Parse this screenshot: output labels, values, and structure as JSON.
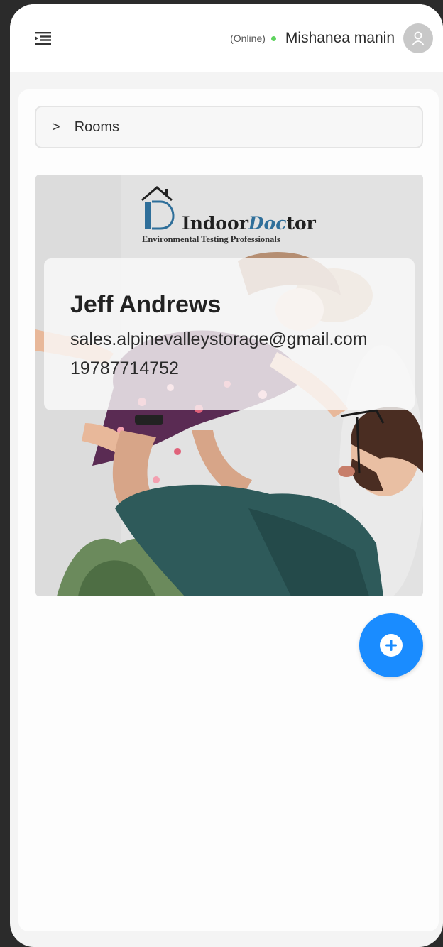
{
  "header": {
    "menu_icon": "menu-collapse-icon",
    "status_text": "(Online)",
    "status_color": "#5fd35f",
    "user_name": "Mishanea manin",
    "avatar_icon": "user-icon"
  },
  "rooms": {
    "label": "Rooms",
    "chevron": ">"
  },
  "customer_card": {
    "logo": {
      "brand_part1": "Indoor",
      "brand_part2": "Doc",
      "brand_part3": "tor",
      "tagline": "Environmental Testing Professionals",
      "accent_color": "#2f6f9a"
    },
    "name": "Jeff Andrews",
    "email": "sales.alpinevalleystorage@gmail.com",
    "phone": "19787714752"
  },
  "fab": {
    "icon": "plus-icon",
    "color": "#1a8cff"
  }
}
